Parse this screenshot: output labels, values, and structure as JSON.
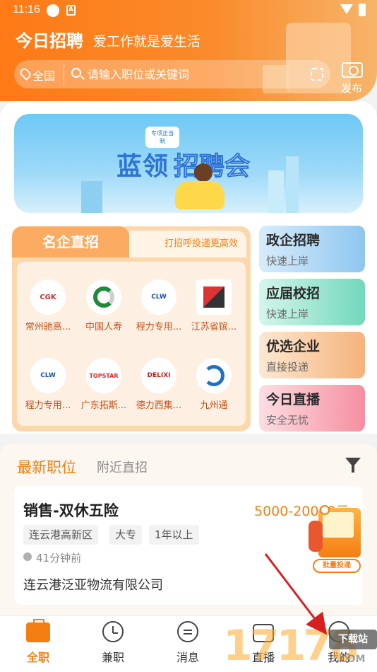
{
  "status_bar": {
    "time": "11:16",
    "notif_letter": "A"
  },
  "header": {
    "title": "今日招聘",
    "slogan": "爱工作就是爱生活",
    "location": "全国",
    "search_placeholder": "请输入职位或关键词",
    "post_label": "发布"
  },
  "banner": {
    "tag": "专项正当制",
    "title_part1": "蓝领",
    "title_part2": "招聘会"
  },
  "famous": {
    "tab_label": "名企直招",
    "tip": "打招呼投递更高效",
    "companies": [
      {
        "name": "常州驰高...",
        "logo_text": "CGK"
      },
      {
        "name": "中国人寿",
        "logo_text": ""
      },
      {
        "name": "程力专用...",
        "logo_text": "CLW"
      },
      {
        "name": "江苏省镔...",
        "logo_text": ""
      },
      {
        "name": "程力专用...",
        "logo_text": "CLW"
      },
      {
        "name": "广东拓斯...",
        "logo_text": "TOPSTAR"
      },
      {
        "name": "德力西集...",
        "logo_text": "DELIXI"
      },
      {
        "name": "九州通",
        "logo_text": ""
      }
    ]
  },
  "side_cards": [
    {
      "title": "政企招聘",
      "sub": "快速上岸"
    },
    {
      "title": "应届校招",
      "sub": "快速上岸"
    },
    {
      "title": "优选企业",
      "sub": "直接投递"
    },
    {
      "title": "今日直播",
      "sub": "安全无忧"
    }
  ],
  "jobs_tabs": {
    "latest": "最新职位",
    "nearby": "附近直招"
  },
  "job": {
    "title": "销售-双休五险",
    "salary": "5000-20000元",
    "tags": [
      "连云港高新区",
      "大专",
      "1年以上"
    ],
    "time_ago": "41分钟前",
    "company": "连云港泛亚物流有限公司"
  },
  "float_button": {
    "label": "批量投递"
  },
  "bottom_nav": [
    {
      "label": "全职",
      "active": true
    },
    {
      "label": "兼职",
      "active": false
    },
    {
      "label": "消息",
      "active": false
    },
    {
      "label": "直播",
      "active": false
    },
    {
      "label": "我的",
      "active": false
    }
  ],
  "watermark": {
    "number": "17178",
    "download": "下载站",
    "domain": ".COM"
  },
  "colors": {
    "accent": "#f57e13",
    "header_start": "#fd7a16",
    "header_end": "#f7b46a"
  }
}
